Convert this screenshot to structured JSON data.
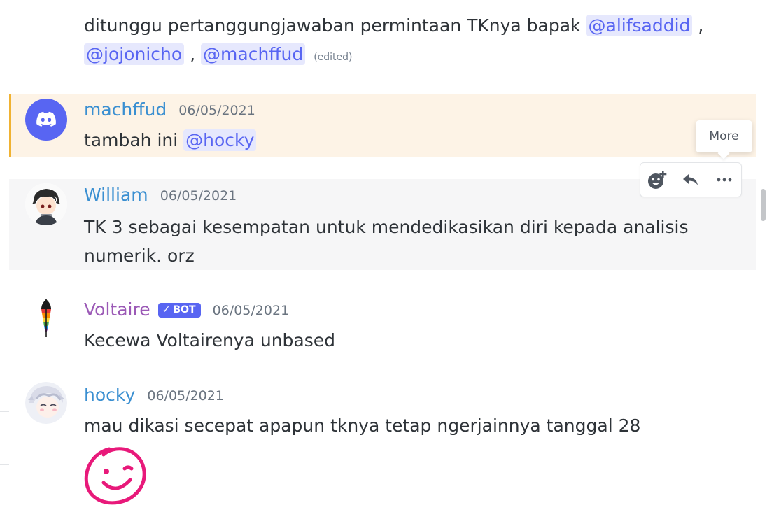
{
  "messages": [
    {
      "prefix_text": "ditunggu pertanggungjawaban permintaan TKnya bapak",
      "mentions": [
        "@alifsaddid",
        "@jojonicho",
        "@machffud"
      ],
      "separator": ",",
      "edited_label": "(edited)"
    },
    {
      "author": "machffud",
      "timestamp": "06/05/2021",
      "text": "tambah ini",
      "mention": "@hocky",
      "avatar_icon": "discord-logo-icon"
    },
    {
      "author": "William",
      "timestamp": "06/05/2021",
      "text": "TK 3 sebagai kesempatan untuk mendedikasikan diri kepada analisis numerik. orz",
      "avatar_icon": "anime-avatar"
    },
    {
      "author": "Voltaire",
      "bot_tag": "BOT",
      "timestamp": "06/05/2021",
      "text": "Kecewa Voltairenya unbased",
      "avatar_icon": "rainbow-feather-icon"
    },
    {
      "author": "hocky",
      "timestamp": "06/05/2021",
      "text": "mau dikasi secepat apapun tknya tetap ngerjainnya tanggal 28",
      "avatar_icon": "anime-avatar",
      "attachment": "smiley-sticker"
    }
  ],
  "toolbar": {
    "tooltip": "More",
    "buttons": [
      "add-reaction-icon",
      "reply-icon",
      "more-icon"
    ]
  },
  "colors": {
    "mention_bg": "#e6e8fd",
    "mention_text": "#5865f2",
    "author_blue": "#3a8fd1",
    "bot_author": "#9b59b6",
    "highlight_bg": "#fdf3e6",
    "highlight_bar": "#f0b232",
    "sticker": "#e8197a"
  }
}
